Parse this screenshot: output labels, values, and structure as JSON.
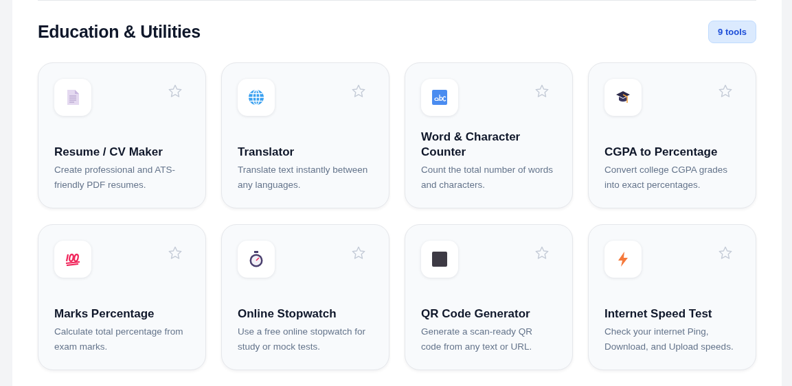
{
  "section": {
    "title": "Education & Utilities",
    "count_badge": "9 tools"
  },
  "tools": [
    {
      "kind": "document",
      "title": "Resume / CV Maker",
      "description": "Create professional and ATS-friendly PDF resumes.",
      "favorite": false
    },
    {
      "kind": "globe",
      "title": "Translator",
      "description": "Translate text instantly between any languages.",
      "favorite": false
    },
    {
      "kind": "abc",
      "title": "Word & Character Counter",
      "description": "Count the total number of words and characters.",
      "favorite": false
    },
    {
      "kind": "cap",
      "title": "CGPA to Percentage",
      "description": "Convert college CGPA grades into exact percentages.",
      "favorite": false
    },
    {
      "kind": "hundred",
      "title": "Marks Percentage",
      "description": "Calculate total percentage from exam marks.",
      "favorite": false
    },
    {
      "kind": "stopwatch",
      "title": "Online Stopwatch",
      "description": "Use a free online stopwatch for study or mock tests.",
      "favorite": false
    },
    {
      "kind": "square",
      "title": "QR Code Generator",
      "description": "Generate a scan-ready QR code from any text or URL.",
      "favorite": false
    },
    {
      "kind": "bolt",
      "title": "Internet Speed Test",
      "description": "Check your internet Ping, Download, and Upload speeds.",
      "favorite": false
    }
  ]
}
